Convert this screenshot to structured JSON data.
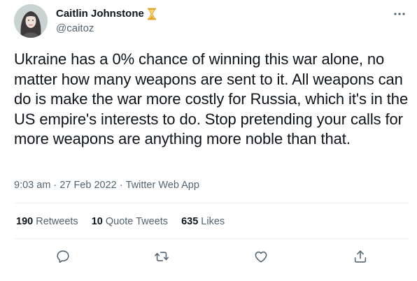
{
  "author": {
    "display_name": "Caitlin Johnstone",
    "handle": "@caitoz",
    "badge_icon": "hourglass-icon"
  },
  "tweet": {
    "text": "Ukraine has a 0% chance of winning this war alone, no matter how many weapons are sent to it. All weapons can do is make the war more costly for Russia, which it's in the US empire's interests to do. Stop pretending your calls for more weapons are anything more noble than that."
  },
  "meta": {
    "time": "9:03 am",
    "separator": " · ",
    "date": "27 Feb 2022",
    "source": "Twitter Web App"
  },
  "stats": {
    "retweets_count": "190",
    "retweets_label": "Retweets",
    "quote_count": "10",
    "quote_label": "Quote Tweets",
    "likes_count": "635",
    "likes_label": "Likes"
  },
  "actions": [
    "reply-icon",
    "retweet-icon",
    "like-icon",
    "share-icon"
  ],
  "colors": {
    "text_primary": "#0f1419",
    "text_secondary": "#536471",
    "divider": "#eff3f4",
    "badge": "#e0a526"
  }
}
